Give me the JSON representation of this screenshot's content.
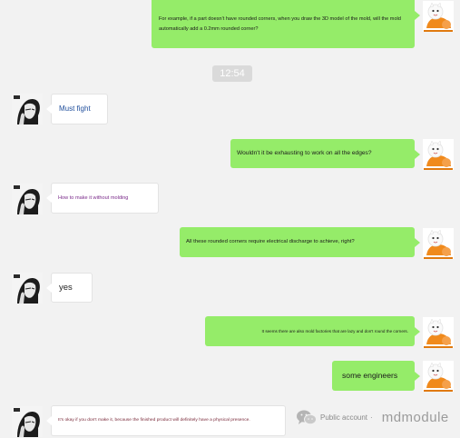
{
  "timestamp": "12:54",
  "messages": [
    {
      "side": "right",
      "text": "For example, if a part doesn't have rounded corners, when you draw the 3D model of the mold, will the mold automatically add a 0.2mm rounded corner?"
    },
    {
      "side": "left",
      "text": "Must fight"
    },
    {
      "side": "right",
      "text": "Wouldn't it be exhausting to work on all the edges?"
    },
    {
      "side": "left",
      "text": "How to make it without molding"
    },
    {
      "side": "right",
      "text": "All these rounded corners require electrical discharge to achieve, right?"
    },
    {
      "side": "left",
      "text": "yes"
    },
    {
      "side": "right",
      "text": "It seems there are also mold factories that are lazy and don't round the corners."
    },
    {
      "side": "right",
      "text": "some engineers"
    },
    {
      "side": "left",
      "text": "It's okay if you don't make it, because the finished product will definitely have a physical presence."
    }
  ],
  "watermark": {
    "icon": "wechat-icon",
    "public_label": "Public account",
    "dot": "·",
    "name": "mdmodule"
  },
  "colors": {
    "background": "#f2f2f2",
    "green_bubble": "#95ec69",
    "white_bubble": "#ffffff",
    "time_badge": "#dadada"
  }
}
